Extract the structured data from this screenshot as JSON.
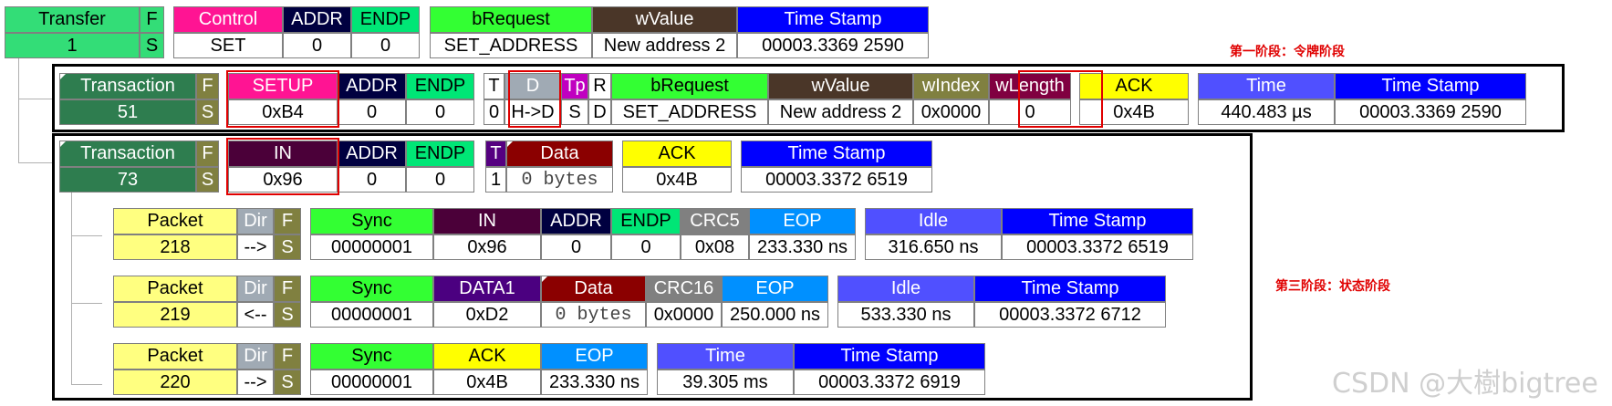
{
  "colors": {
    "control_pink": "#ff1493",
    "navy": "#000040",
    "endp_green": "#00e676",
    "lime": "#33ff33",
    "brown": "#4a3628",
    "blue": "#0000ff",
    "gray": "#a0aab4",
    "purple_tp": "#c000c0",
    "teal": "#2e7d4f",
    "olive": "#808040",
    "wlength_maroon": "#800040",
    "yellow": "#ffff00",
    "time_purple": "#5050ff",
    "packet_yellow": "#ffff80",
    "in_purple": "#4b0039",
    "data_red": "#8b0000",
    "t_purple": "#550080",
    "crc_gray": "#808080",
    "eop_blue": "#0090ff",
    "data1_purple": "#4b0080",
    "annot_red": "#e00000"
  },
  "transfer": {
    "h": [
      "Transfer",
      "F",
      "Control",
      "ADDR",
      "ENDP",
      "bRequest",
      "wValue",
      "Time Stamp"
    ],
    "v": [
      "1",
      "S",
      "SET",
      "0",
      "0",
      "SET_ADDRESS",
      "New address 2",
      "00003.3369 2590"
    ]
  },
  "setup_txn": {
    "h": [
      "Transaction",
      "F",
      "SETUP",
      "ADDR",
      "ENDP",
      "T",
      "D",
      "Tp",
      "R",
      "bRequest",
      "wValue",
      "wIndex",
      "wLength",
      "ACK",
      "Time",
      "Time Stamp"
    ],
    "v": [
      "51",
      "S",
      "0xB4",
      "0",
      "0",
      "0",
      "H->D",
      "S",
      "D",
      "SET_ADDRESS",
      "New address 2",
      "0x0000",
      "0",
      "0x4B",
      "440.483 µs",
      "00003.3369 2590"
    ]
  },
  "in_txn": {
    "h": [
      "Transaction",
      "F",
      "IN",
      "ADDR",
      "ENDP",
      "T",
      "Data",
      "ACK",
      "Time Stamp"
    ],
    "v": [
      "73",
      "S",
      "0x96",
      "0",
      "0",
      "1",
      "0 bytes",
      "0x4B",
      "00003.3372 6519"
    ]
  },
  "packet218": {
    "h": [
      "Packet",
      "Dir",
      "F",
      "Sync",
      "IN",
      "ADDR",
      "ENDP",
      "CRC5",
      "EOP",
      "Idle",
      "Time Stamp"
    ],
    "v": [
      "218",
      "-->",
      "S",
      "00000001",
      "0x96",
      "0",
      "0",
      "0x08",
      "233.330 ns",
      "316.650 ns",
      "00003.3372 6519"
    ]
  },
  "packet219": {
    "h": [
      "Packet",
      "Dir",
      "F",
      "Sync",
      "DATA1",
      "Data",
      "CRC16",
      "EOP",
      "Idle",
      "Time Stamp"
    ],
    "v": [
      "219",
      "<--",
      "S",
      "00000001",
      "0xD2",
      "0 bytes",
      "0x0000",
      "250.000 ns",
      "533.330 ns",
      "00003.3372 6712"
    ]
  },
  "packet220": {
    "h": [
      "Packet",
      "Dir",
      "F",
      "Sync",
      "ACK",
      "EOP",
      "Time",
      "Time Stamp"
    ],
    "v": [
      "220",
      "-->",
      "S",
      "00000001",
      "0x4B",
      "233.330 ns",
      "39.305 ms",
      "00003.3372 6919"
    ]
  },
  "annotations": {
    "stage1": "第一阶段：令牌阶段",
    "stage3": "第三阶段：状态阶段"
  },
  "watermark": "CSDN @大樹bigtree"
}
